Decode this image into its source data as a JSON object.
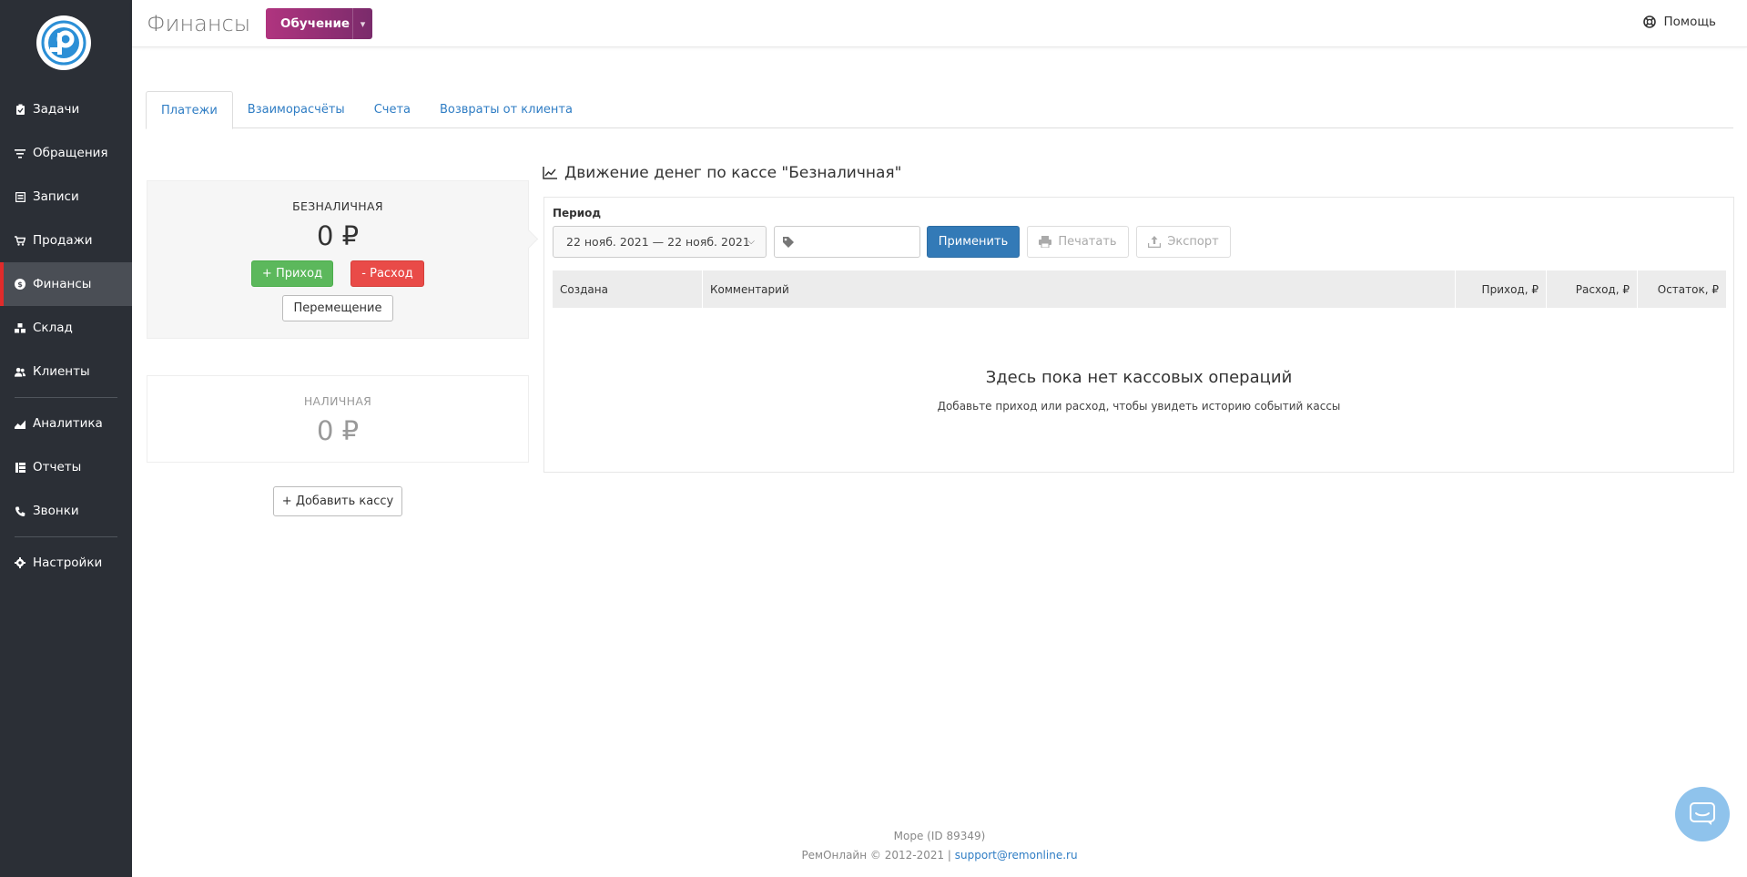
{
  "sidebar": {
    "items": [
      {
        "label": "Задачи",
        "icon": "clipboard-icon"
      },
      {
        "label": "Обращения",
        "icon": "filter-icon"
      },
      {
        "label": "Записи",
        "icon": "calendar-icon"
      },
      {
        "label": "Продажи",
        "icon": "cart-icon"
      },
      {
        "label": "Финансы",
        "icon": "dollar-icon",
        "active": true
      },
      {
        "label": "Склад",
        "icon": "boxes-icon"
      },
      {
        "label": "Клиенты",
        "icon": "users-icon"
      },
      {
        "label": "Аналитика",
        "icon": "chart-icon"
      },
      {
        "label": "Отчеты",
        "icon": "table-icon"
      },
      {
        "label": "Звонки",
        "icon": "phone-icon"
      },
      {
        "label": "Настройки",
        "icon": "gear-icon"
      }
    ]
  },
  "header": {
    "title": "Финансы",
    "learn_label": "Обучение",
    "help_label": "Помощь"
  },
  "tabs": [
    {
      "label": "Платежи",
      "active": true
    },
    {
      "label": "Взаиморасчёты"
    },
    {
      "label": "Счета"
    },
    {
      "label": "Возвраты от клиента"
    }
  ],
  "cashboxes": {
    "selected": {
      "name": "БЕЗНАЛИЧНАЯ",
      "amount": "0 ₽",
      "income_label": "+ Приход",
      "expense_label": "- Расход",
      "move_label": "Перемещение"
    },
    "other": {
      "name": "НАЛИЧНАЯ",
      "amount": "0 ₽"
    },
    "add_label": "+ Добавить кассу"
  },
  "movement": {
    "title": "Движение денег по кассе \"Безналичная\"",
    "period_label": "Период",
    "date_range": "22 нояб. 2021 — 22 нояб. 2021",
    "apply_label": "Применить",
    "print_label": "Печатать",
    "export_label": "Экспорт",
    "columns": [
      "Создана",
      "Комментарий",
      "Приход, ₽",
      "Расход, ₽",
      "Остаток, ₽"
    ],
    "empty_title": "Здесь пока нет кассовых операций",
    "empty_subtitle": "Добавьте приход или расход, чтобы увидеть историю событий кассы"
  },
  "footer": {
    "company": "Море (ID 89349)",
    "copyright": "РемОнлайн © 2012-2021 | ",
    "support_email": "support@remonline.ru"
  },
  "colors": {
    "sidebar_bg": "#2b2f36",
    "active_marker": "#e02b2b",
    "primary": "#337ab7",
    "success": "#5cb85c",
    "danger": "#e94b48",
    "link": "#2f7dc4"
  }
}
